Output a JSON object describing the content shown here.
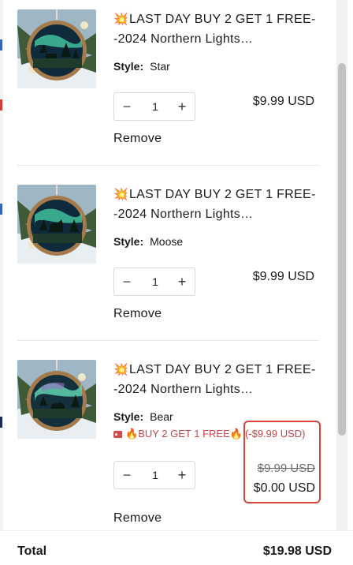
{
  "cart": {
    "items": [
      {
        "title_prefix": "💥",
        "title": "LAST DAY BUY 2 GET 1 FREE--2024 Northern Lights…",
        "style_label": "Style:",
        "style_value": "Star",
        "quantity": "1",
        "price": "$9.99 USD",
        "remove_label": "Remove",
        "thumb_variant": "star"
      },
      {
        "title_prefix": "💥",
        "title": "LAST DAY BUY 2 GET 1 FREE--2024 Northern Lights…",
        "style_label": "Style:",
        "style_value": "Moose",
        "quantity": "1",
        "price": "$9.99 USD",
        "remove_label": "Remove",
        "thumb_variant": "moose"
      },
      {
        "title_prefix": "💥",
        "title": "LAST DAY BUY 2 GET 1 FREE--2024 Northern Lights…",
        "style_label": "Style:",
        "style_value": "Bear",
        "promo_fire": "🔥",
        "promo_text": "BUY 2 GET 1 FREE",
        "promo_discount": "(-$9.99 USD)",
        "quantity": "1",
        "original_price": "$9.99 USD",
        "final_price": "$0.00 USD",
        "remove_label": "Remove",
        "thumb_variant": "bear"
      }
    ],
    "qty_minus": "−",
    "qty_plus": "+"
  },
  "footer": {
    "total_label": "Total",
    "total_value": "$19.98 USD"
  },
  "colors": {
    "promo": "#c2484a",
    "highlight_box": "#d8443a"
  }
}
